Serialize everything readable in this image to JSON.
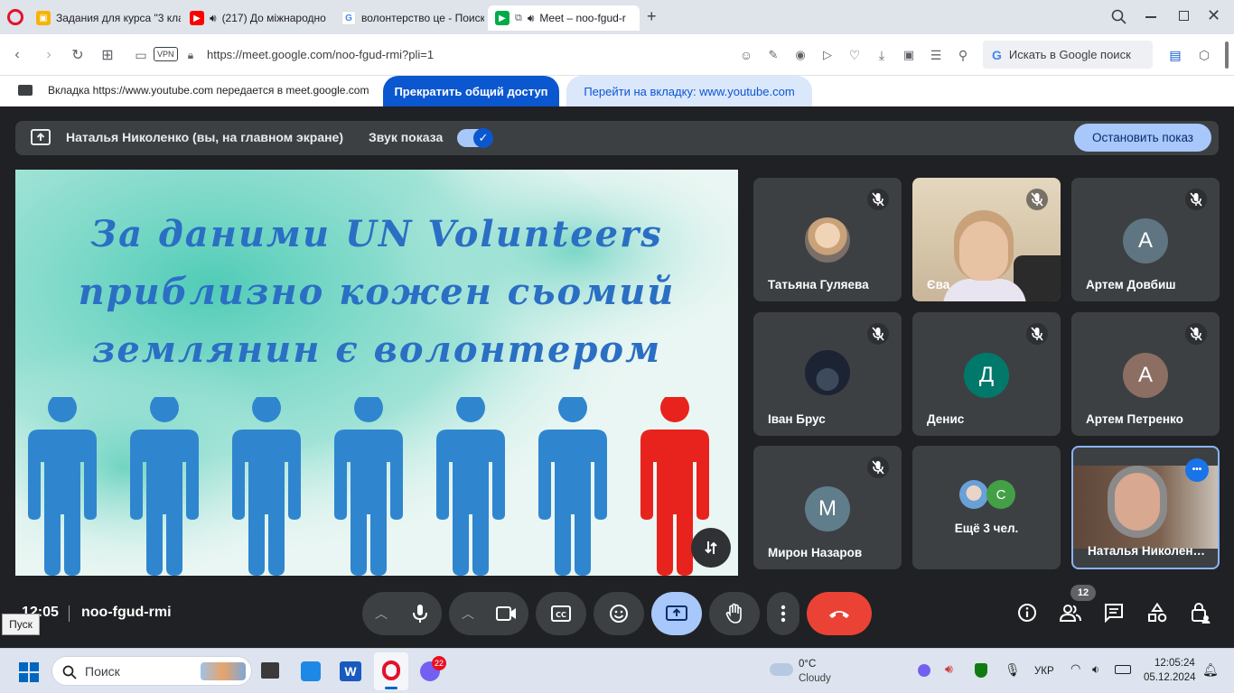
{
  "browser": {
    "tabs": [
      {
        "label": "Задания для курса \"3 кла",
        "icon": "classroom-icon"
      },
      {
        "label": "(217) До міжнародно",
        "icon": "youtube-icon"
      },
      {
        "label": "волонтерство це - Поиск",
        "icon": "google-icon"
      },
      {
        "label": "Meet – noo-fgud-r",
        "icon": "meet-icon"
      }
    ],
    "url": "https://meet.google.com/noo-fgud-rmi?pli=1",
    "vpn": "VPN",
    "search_label": "Искать в Google поиск"
  },
  "share_bar": {
    "text": "Вкладка https://www.youtube.com передается в meet.google.com",
    "stop_label": "Прекратить общий доступ",
    "switch_label": "Перейти на вкладку: www.youtube.com"
  },
  "presenting": {
    "name": "Наталья Николенко (вы, на главном экране)",
    "sound_label": "Звук показа",
    "stop_label": "Остановить показ"
  },
  "slide": {
    "line1": "За даними UN Volunteers",
    "line2": "приблизно кожен сьомий",
    "line3": "землянин є волонтером"
  },
  "participants": [
    {
      "name": "Татьяна Гуляева",
      "avatar": "photo",
      "muted": true
    },
    {
      "name": "Єва",
      "avatar": "video",
      "muted": true
    },
    {
      "name": "Артем Довбиш",
      "avatar": "A",
      "muted": true,
      "color": "#5f7581"
    },
    {
      "name": "Іван Брус",
      "avatar": "photo",
      "muted": true
    },
    {
      "name": "Денис",
      "avatar": "Д",
      "muted": true,
      "color": "#00796b"
    },
    {
      "name": "Артем Петренко",
      "avatar": "A",
      "muted": true,
      "color": "#8d6e63"
    },
    {
      "name": "Мирон Назаров",
      "avatar": "M",
      "muted": true,
      "color": "#607d8b"
    },
    {
      "name": "Ещё 3 чел.",
      "avatar": "C",
      "muted": false,
      "color": "#43a047"
    },
    {
      "name": "Наталья Николен…",
      "avatar": "video",
      "muted": false
    }
  ],
  "meeting": {
    "time": "12:05",
    "code": "noo-fgud-rmi",
    "people_count": "12"
  },
  "taskbar": {
    "start_tooltip": "Пуск",
    "search_placeholder": "Поиск",
    "viber_badge": "22",
    "weather_temp": "0°C",
    "weather_desc": "Cloudy",
    "language": "УКР",
    "time": "12:05:24",
    "date": "05.12.2024"
  },
  "colors": {
    "accent_blue": "#0b57d0",
    "end_call_red": "#ea4335",
    "meet_bg": "#202124",
    "tile_bg": "#3c4043",
    "person_blue": "#2f86cf",
    "person_red": "#e8231d"
  }
}
